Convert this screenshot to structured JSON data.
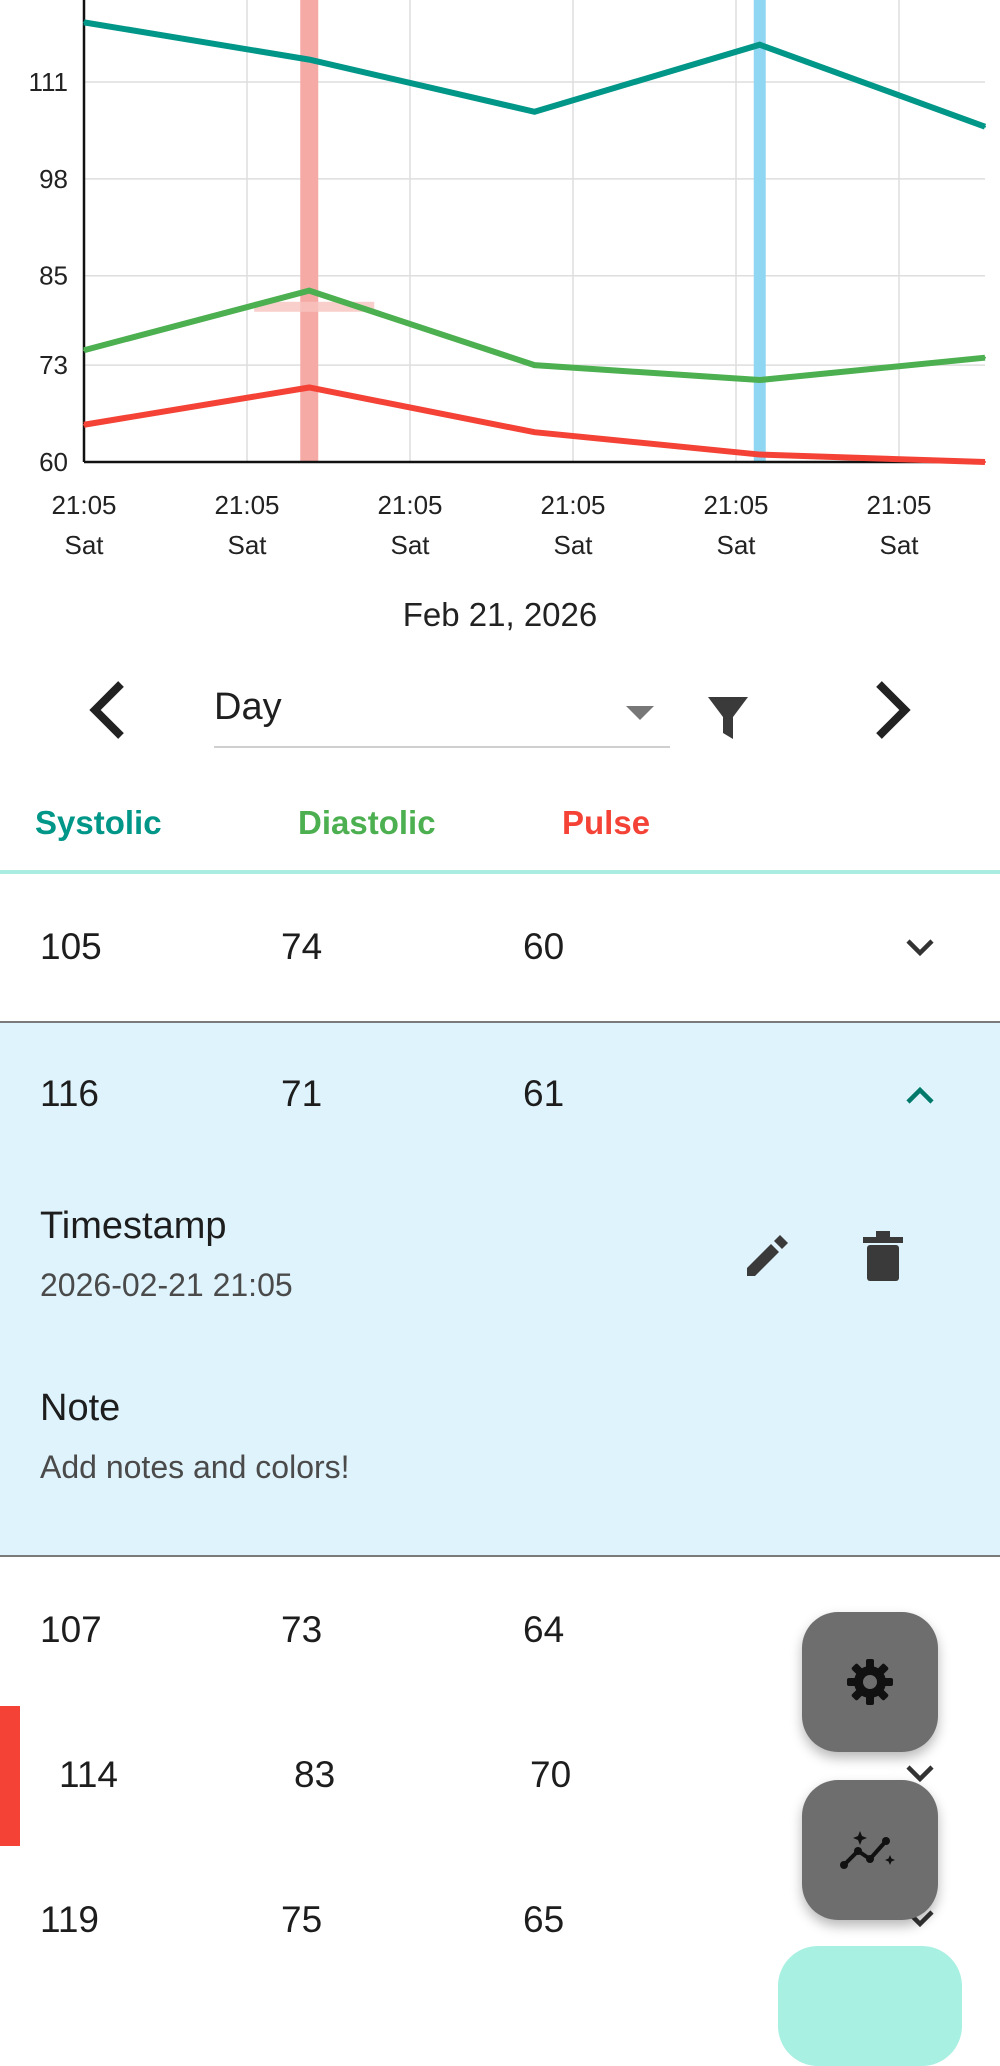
{
  "chart_data": {
    "type": "line",
    "x": [
      "21:05 Sat",
      "21:05 Sat",
      "21:05 Sat",
      "21:05 Sat",
      "21:05 Sat",
      "21:05 Sat"
    ],
    "y_ticks": [
      "60",
      "73",
      "85",
      "98",
      "111"
    ],
    "ylim": [
      60,
      122
    ],
    "x_tick_labels": [
      {
        "time": "21:05",
        "day": "Sat"
      },
      {
        "time": "21:05",
        "day": "Sat"
      },
      {
        "time": "21:05",
        "day": "Sat"
      },
      {
        "time": "21:05",
        "day": "Sat"
      },
      {
        "time": "21:05",
        "day": "Sat"
      },
      {
        "time": "21:05",
        "day": "Sat"
      }
    ],
    "grid": true,
    "series": [
      {
        "color": "#009688",
        "values": [
          119,
          114,
          107,
          116,
          105
        ]
      },
      {
        "color": "#4caf50",
        "values": [
          75,
          83,
          73,
          71,
          74
        ]
      },
      {
        "color": "#f44336",
        "values": [
          65,
          70,
          64,
          61,
          60
        ]
      }
    ],
    "highlight_red_index": 1,
    "highlight_blue_index": 3
  },
  "date_label": "Feb 21, 2026",
  "nav": {
    "period": "Day",
    "prev_icon": "chevron-left-icon",
    "next_icon": "chevron-right-icon",
    "filter_icon": "filter-icon"
  },
  "columns": {
    "systolic": "Systolic",
    "diastolic": "Diastolic",
    "pulse": "Pulse"
  },
  "colors": {
    "systolic": "#009688",
    "diastolic": "#4caf50",
    "pulse": "#f44336",
    "selected_bg": "#dff3fc",
    "fab": "#6e6e6e",
    "fab_main": "#a8f0e2"
  },
  "rows": [
    {
      "systolic": "105",
      "diastolic": "74",
      "pulse": "60"
    },
    {
      "systolic": "116",
      "diastolic": "71",
      "pulse": "61"
    },
    {
      "systolic": "107",
      "diastolic": "73",
      "pulse": "64"
    },
    {
      "systolic": "114",
      "diastolic": "83",
      "pulse": "70"
    },
    {
      "systolic": "119",
      "diastolic": "75",
      "pulse": "65"
    }
  ],
  "expanded": {
    "timestamp_label": "Timestamp",
    "timestamp_value": "2026-02-21 21:05",
    "note_label": "Note",
    "note_value": "Add notes and colors!"
  }
}
